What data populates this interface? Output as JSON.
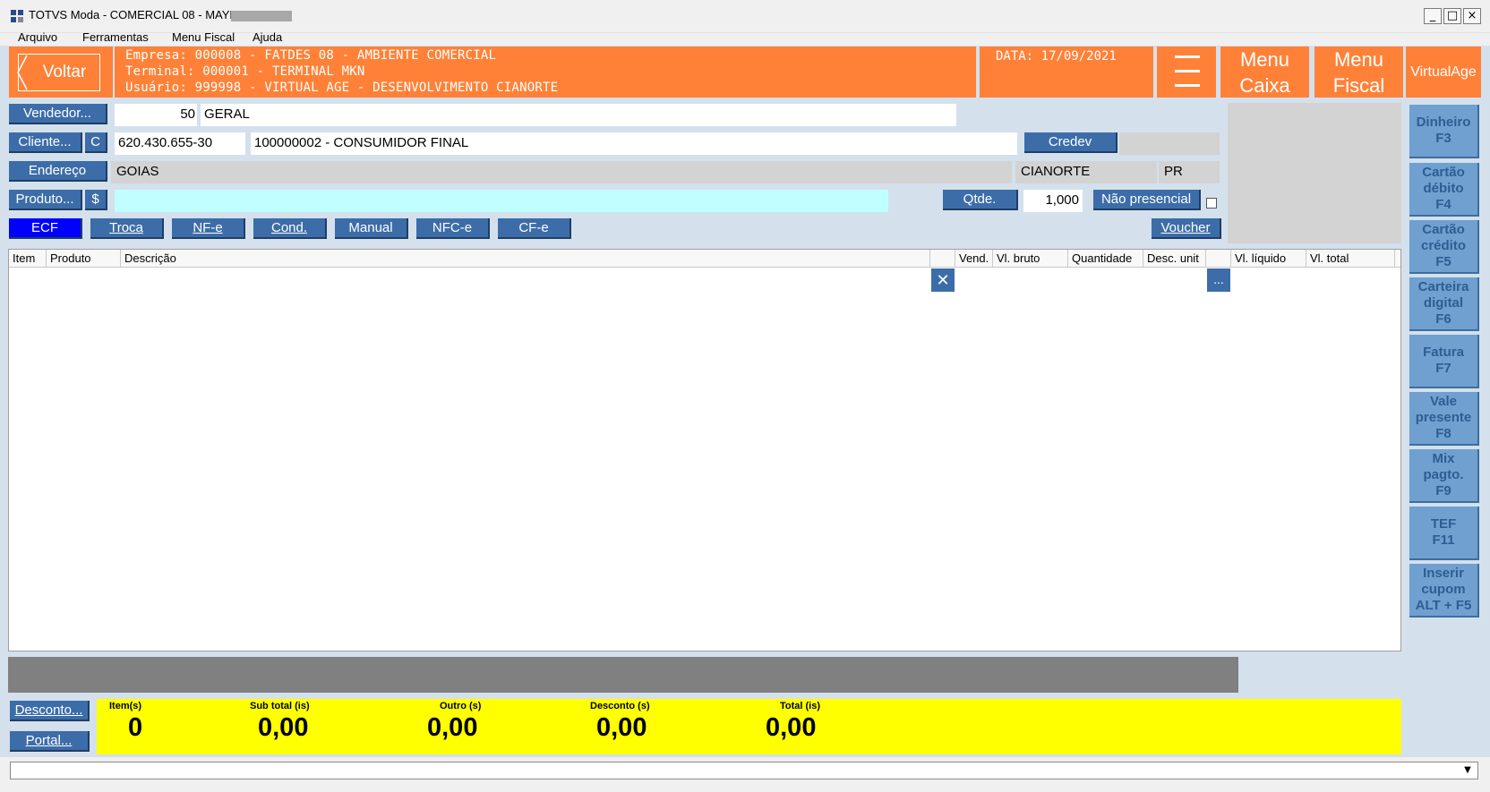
{
  "window": {
    "title": "TOTVS Moda - COMERCIAL 08 - MAYKON",
    "minimize": "_",
    "maximize": "□",
    "close": "×"
  },
  "menu": [
    "Arquivo",
    "Ferramentas",
    "Menu Fiscal",
    "Ajuda"
  ],
  "header": {
    "voltar": "Voltar",
    "empresa": "Empresa: 000008 - FATDES 08 - AMBIENTE COMERCIAL",
    "terminal": "Terminal: 000001 - TERMINAL MKN",
    "usuario": "Usuário: 999998 - VIRTUAL AGE - DESENVOLVIMENTO CIANORTE",
    "data": "DATA: 17/09/2021",
    "menu_caixa": [
      "Menu",
      "Caixa"
    ],
    "menu_fiscal": [
      "Menu",
      "Fiscal"
    ],
    "virtualage": "VirtualAge"
  },
  "form": {
    "vendedor_btn": "Vendedor...",
    "vendedor_code": "50",
    "vendedor_name": "GERAL",
    "cliente_btn": "Cliente...",
    "cliente_c": "C",
    "cliente_doc": "620.430.655-30",
    "cliente_name": "100000002 - CONSUMIDOR FINAL",
    "credev": "Credev",
    "endereco_btn": "Endereço",
    "endereco": "GOIAS",
    "cidade": "CIANORTE",
    "uf": "PR",
    "produto_btn": "Produto...",
    "produto_dollar": "$",
    "produto_value": "",
    "qtde_btn": "Qtde.",
    "qtde_value": "1,000",
    "nao_presencial": "Não presencial"
  },
  "doc_buttons": [
    "ECF",
    "Troca",
    "NF-e",
    "Cond.",
    "Manual",
    "NFC-e",
    "CF-e"
  ],
  "voucher": "Voucher",
  "grid": {
    "columns": [
      "Item",
      "Produto",
      "Descrição",
      "",
      "Vend.",
      "Vl. bruto",
      "Quantidade",
      "Desc. unit",
      "",
      "Vl. líquido",
      "Vl. total"
    ],
    "rows": [],
    "delete_btn": "✕",
    "more_btn": "..."
  },
  "bottom": {
    "desconto_btn": "Desconto...",
    "portal_btn": "Portal...",
    "totals": [
      {
        "label": "Item(s)",
        "value": "0"
      },
      {
        "label": "Sub total (is)",
        "value": "0,00"
      },
      {
        "label": "Outro (s)",
        "value": "0,00"
      },
      {
        "label": "Desconto (s)",
        "value": "0,00"
      },
      {
        "label": "Total (is)",
        "value": "0,00"
      }
    ]
  },
  "payments": [
    [
      "Dinheiro",
      "F3"
    ],
    [
      "Cartão",
      "débito",
      "F4"
    ],
    [
      "Cartão",
      "crédito",
      "F5"
    ],
    [
      "Carteira",
      "digital",
      "F6"
    ],
    [
      "Fatura",
      "F7"
    ],
    [
      "Vale",
      "presente",
      "F8"
    ],
    [
      "Mix",
      "pagto.",
      "F9"
    ],
    [
      "TEF",
      "F11"
    ],
    [
      "Inserir",
      "cupom",
      "ALT + F5"
    ]
  ],
  "colors": {
    "orange": "#ff8138",
    "blue_button": "#3c6da8",
    "ecf_active": "#0000ff",
    "product_field": "#c0ffff",
    "totals_bg": "#ffff00",
    "payment_btn": "#6fa0d0"
  }
}
